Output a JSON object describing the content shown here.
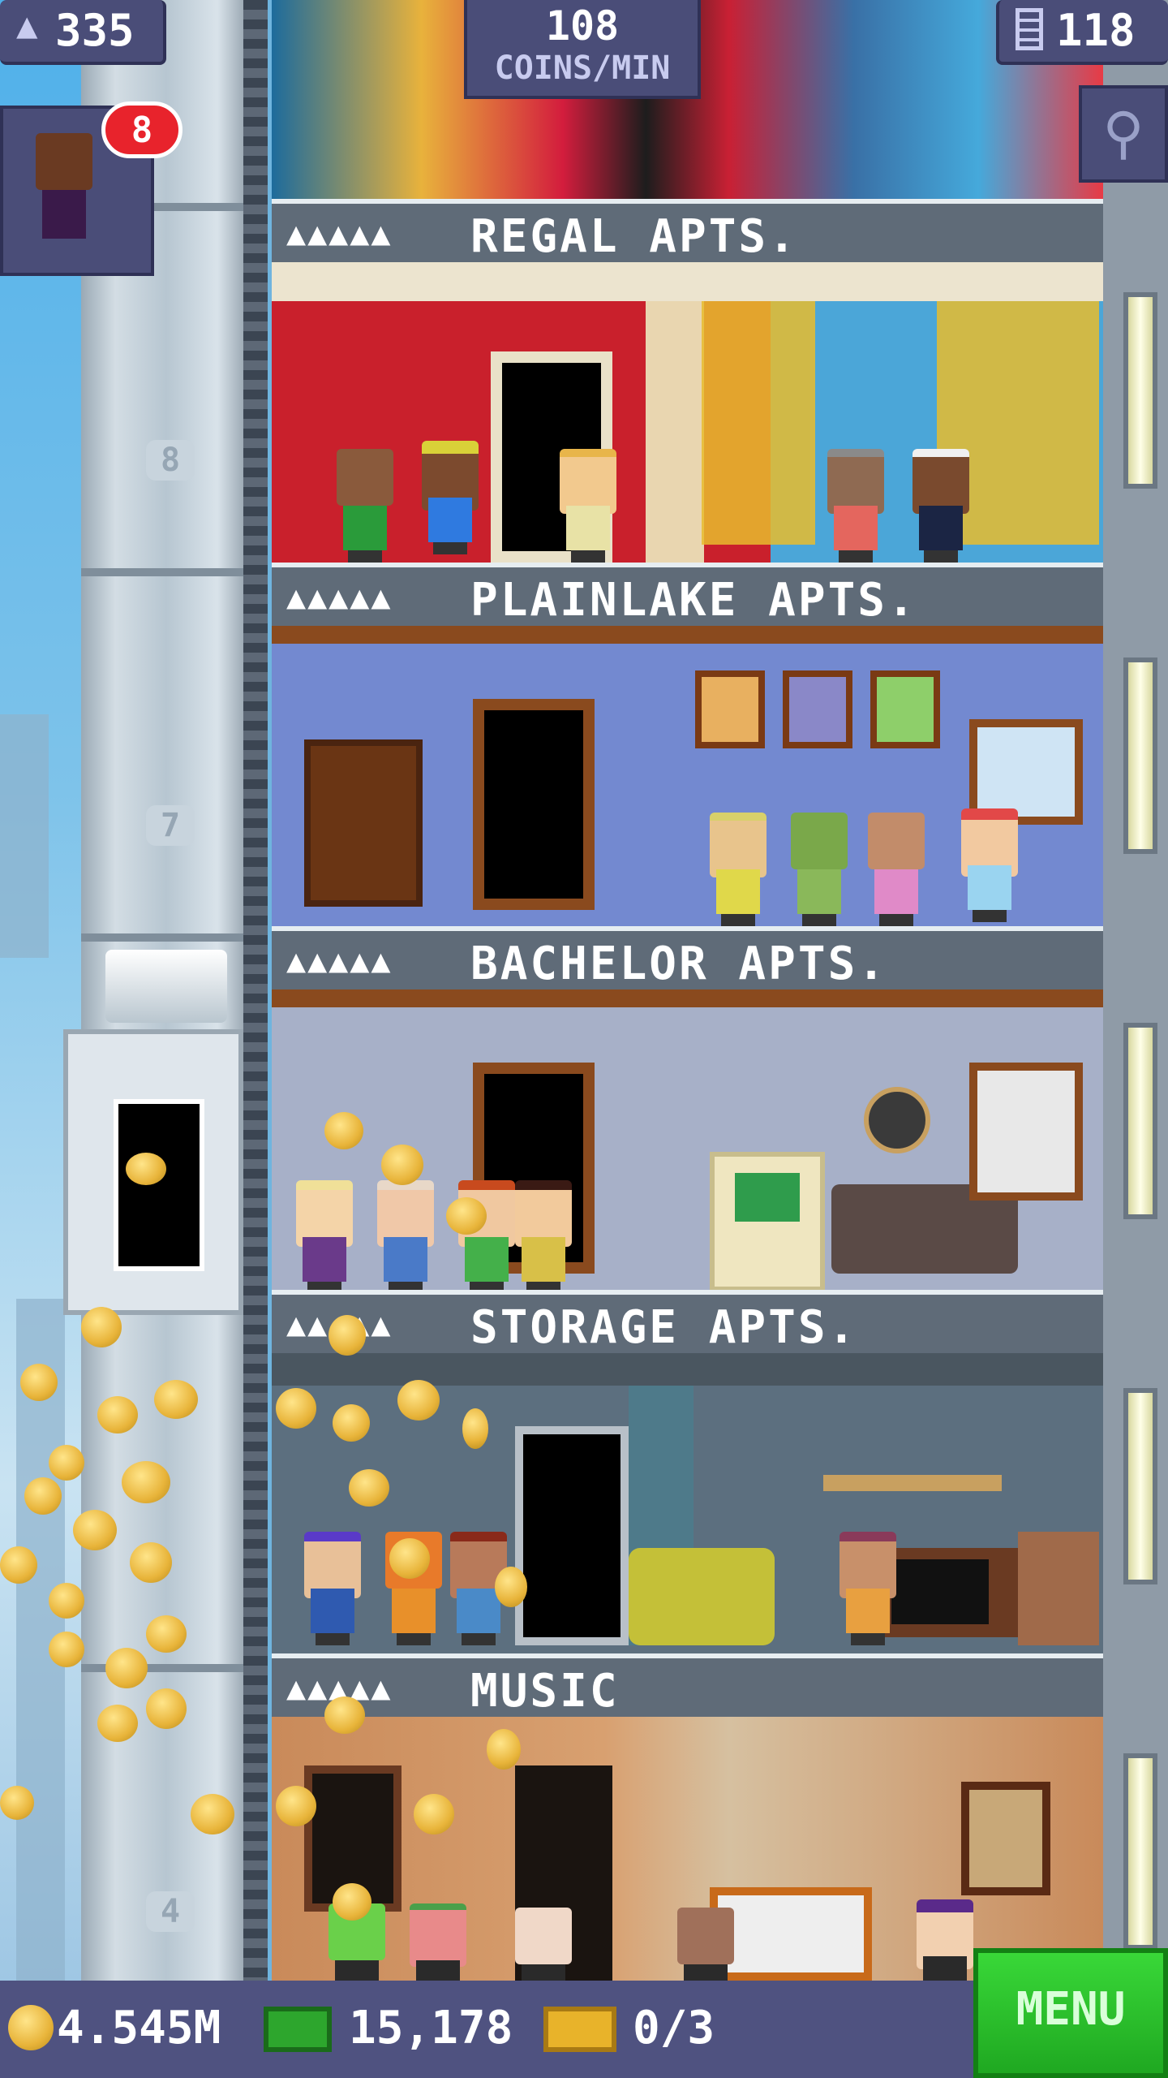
{
  "hud": {
    "population": "335",
    "coins_rate_value": "108",
    "coins_rate_unit": "COINS/MIN",
    "floors": "118"
  },
  "notification": {
    "count": "8"
  },
  "floors": [
    {
      "name": "REGAL APTS.",
      "residents": "▲▲▲▲▲",
      "wall": "#c9202c"
    },
    {
      "name": "PLAINLAKE APTS.",
      "residents": "▲▲▲▲▲",
      "wall": "#7389d0"
    },
    {
      "name": "BACHELOR APTS.",
      "residents": "▲▲▲▲▲",
      "wall": "#a7b0c8"
    },
    {
      "name": "STORAGE APTS.",
      "residents": "▲▲▲▲▲",
      "wall": "#5c6f7f"
    },
    {
      "name": "MUSIC",
      "residents": "▲▲▲▲▲",
      "wall": "#c98a5a"
    }
  ],
  "elevator_numbers": [
    "8",
    "7",
    "4"
  ],
  "bottom": {
    "coins": "4.545M",
    "bux": "15,178",
    "tickets": "0/3",
    "menu_label": "MENU"
  },
  "icons": {
    "population": "person-icon",
    "floors": "building-icon",
    "search": "magnifier-icon",
    "coin": "coin-icon",
    "bux": "banknote-icon",
    "ticket": "ticket-icon"
  },
  "colors": {
    "accent": "#4a4d78",
    "menu": "#2cc22c",
    "badge": "#e8232c"
  }
}
